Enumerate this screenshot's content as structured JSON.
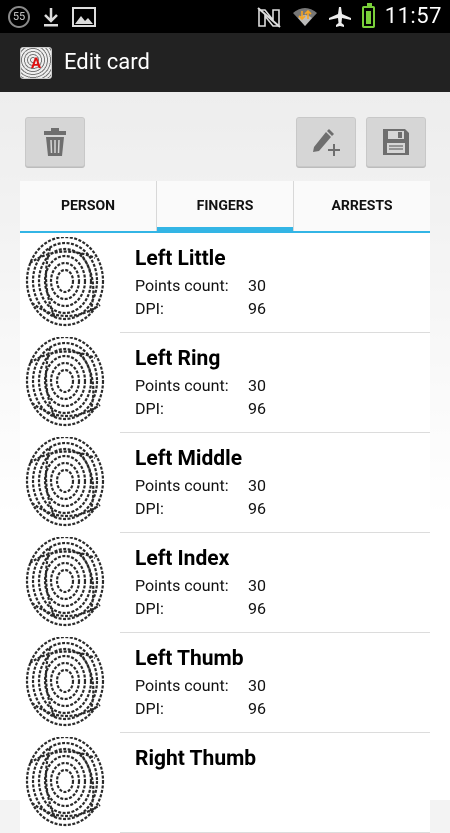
{
  "status_bar": {
    "notification_count": "55",
    "time": "11:57"
  },
  "action_bar": {
    "title": "Edit card",
    "app_icon_letter": "A"
  },
  "tabs": [
    {
      "label": "PERSON",
      "active": false
    },
    {
      "label": "FINGERS",
      "active": true
    },
    {
      "label": "ARRESTS",
      "active": false
    }
  ],
  "field_labels": {
    "points": "Points count:",
    "dpi": "DPI:"
  },
  "fingers": [
    {
      "name": "Left Little",
      "points": "30",
      "dpi": "96"
    },
    {
      "name": "Left Ring",
      "points": "30",
      "dpi": "96"
    },
    {
      "name": "Left Middle",
      "points": "30",
      "dpi": "96"
    },
    {
      "name": "Left Index",
      "points": "30",
      "dpi": "96"
    },
    {
      "name": "Left Thumb",
      "points": "30",
      "dpi": "96"
    },
    {
      "name": "Right Thumb"
    }
  ],
  "colors": {
    "accent": "#33b5e5",
    "action_bar": "#222222",
    "status_bar": "#000000"
  }
}
